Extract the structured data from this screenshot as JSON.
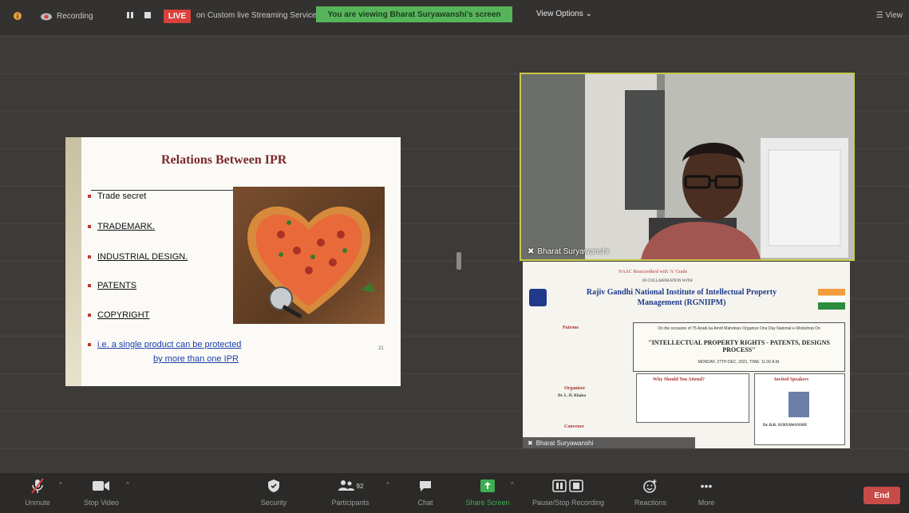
{
  "topbar": {
    "recording_label": "Recording",
    "live_label": "LIVE",
    "streaming_label": "on Custom live Streaming Service",
    "viewing_banner": "You are viewing Bharat Suryawanshi's screen",
    "view_options_label": "View Options",
    "view_label": "View"
  },
  "slide": {
    "title": "Relations Between IPR",
    "bullets": [
      "Trade secret",
      "TRADEMARK.",
      "INDUSTRIAL DESIGN.",
      "PATENTS",
      "COPYRIGHT"
    ],
    "note_line1": "i.e. a single product can be protected",
    "note_line2": "by more than one IPR",
    "page_number": "21"
  },
  "video": {
    "participant_name": "Bharat Suryawanshi"
  },
  "poster": {
    "naac": "NAAC Reaccredited with 'A' Grade",
    "collab": "IN COLLABORATION WITH",
    "institute": "Rajiv Gandhi National Institute of Intellectual Property Management (RGNIIPM)",
    "occasion": "On the occasion of 75 Azadi ka Amrit Mahotsav Organize One Day National e-Workshop On",
    "event_title": "\"INTELLECTUAL PROPERTY RIGHTS - PATENTS, DESIGNS PROCESS\"",
    "date": "MONDAY, 27TH DEC. 2021, TIME: 11.00 A.M.",
    "patron_label": "Patrons",
    "organizer_label": "Organizer",
    "organizer_name": "Dr. L. H. Khalsa",
    "convener_label": "Convener",
    "why_label": "Why Should You Attend?",
    "speaker_label": "Invited Speakers",
    "speaker_name": "Dr. B.R. SURYAWANSHI",
    "tile_name": "Bharat Suryawanshi"
  },
  "toolbar": {
    "unmute": "Unmute",
    "stop_video": "Stop Video",
    "security": "Security",
    "participants": "Participants",
    "participants_count": "92",
    "chat": "Chat",
    "share_screen": "Share Screen",
    "pause_recording": "Pause/Stop Recording",
    "reactions": "Reactions",
    "more": "More",
    "end": "End"
  },
  "colors": {
    "live_red": "#d9413b",
    "banner_green": "#56b55a",
    "speaker_border": "#c8c94a",
    "end_red": "#c74b47"
  }
}
